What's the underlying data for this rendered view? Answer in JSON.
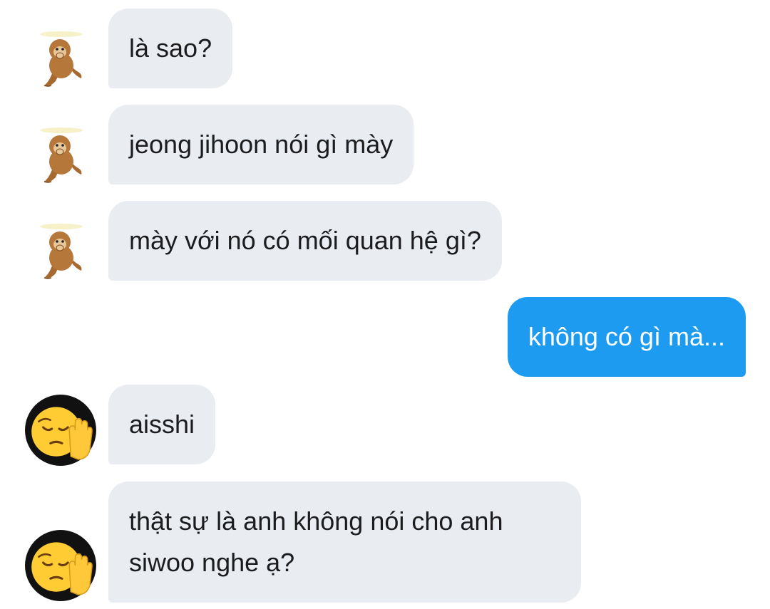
{
  "conversation": {
    "messages": [
      {
        "sender": "other",
        "avatar": "monkey-sticker-icon",
        "text": "là sao?"
      },
      {
        "sender": "other",
        "avatar": "monkey-sticker-icon",
        "text": "jeong jihoon nói gì mày"
      },
      {
        "sender": "other",
        "avatar": "monkey-sticker-icon",
        "text": "mày với nó có mối quan hệ gì?"
      },
      {
        "sender": "self",
        "text": "không có gì mà..."
      },
      {
        "sender": "other",
        "avatar": "pensive-face-raised-hand-emoji-icon",
        "text": "aisshi"
      },
      {
        "sender": "other",
        "avatar": "pensive-face-raised-hand-emoji-icon",
        "text": "thật sự là anh không nói cho anh"
      },
      {
        "sender": "other",
        "avatar": "pensive-face-raised-hand-emoji-icon",
        "text": "siwoo nghe ạ?"
      }
    ]
  },
  "colors": {
    "incoming_bubble": "#e9ecf0",
    "outgoing_bubble": "#1d9bf0",
    "incoming_text": "#1c1c1e",
    "outgoing_text": "#ffffff"
  }
}
